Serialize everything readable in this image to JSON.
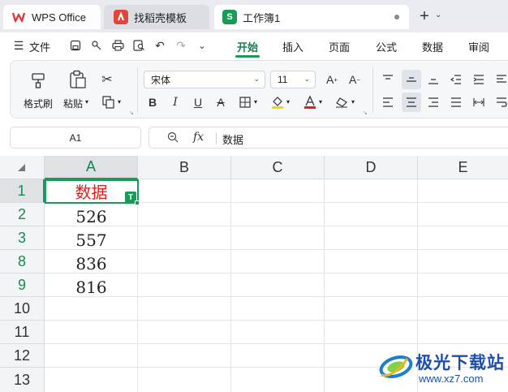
{
  "tabs": {
    "wps": "WPS Office",
    "template": "找稻壳模板",
    "workbook": "工作簿1",
    "workbook_badge": "S"
  },
  "menu": {
    "file": "文件",
    "items": [
      "开始",
      "插入",
      "页面",
      "公式",
      "数据",
      "审阅"
    ],
    "active": "开始"
  },
  "ribbon": {
    "format_painter": "格式刷",
    "paste": "粘贴",
    "font_name": "宋体",
    "font_size": "11"
  },
  "formula_bar": {
    "cell_ref": "A1",
    "fx": "fx",
    "value": "数据"
  },
  "sheet": {
    "columns": [
      "A",
      "B",
      "C",
      "D",
      "E"
    ],
    "rows": [
      "1",
      "2",
      "3",
      "8",
      "9",
      "10",
      "11",
      "12",
      "13"
    ],
    "cells": [
      "数据",
      "526",
      "557",
      "836",
      "816"
    ],
    "badge": "T"
  },
  "watermark": {
    "name": "极光下载站",
    "url": "www.xz7.com"
  },
  "colors": {
    "accent": "#1a9a57",
    "header_text": "#e0201c",
    "watermark": "#1b4fa8"
  }
}
